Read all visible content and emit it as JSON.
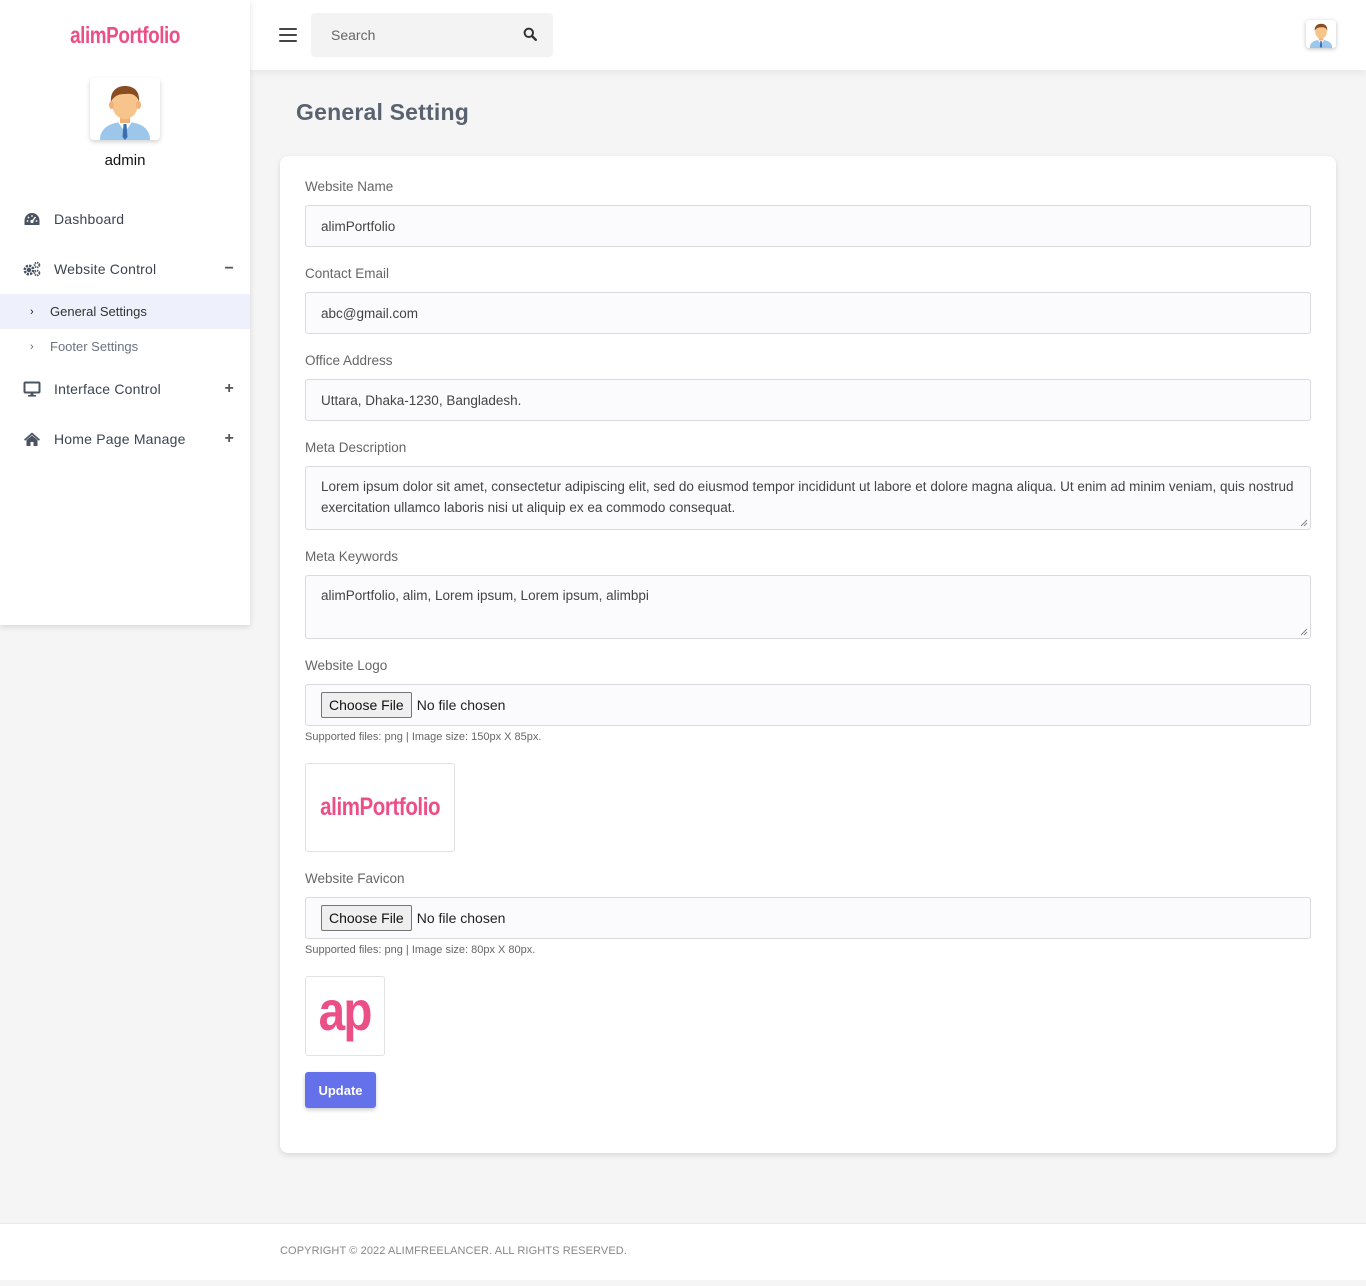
{
  "brand": {
    "name": "alimPortfolio"
  },
  "profile": {
    "name": "admin"
  },
  "nav": {
    "items": [
      {
        "label": "Dashboard",
        "icon": "dashboard-icon"
      },
      {
        "label": "Website Control",
        "icon": "cogs-icon",
        "toggle": "−"
      },
      {
        "label": "Interface Control",
        "icon": "monitor-icon",
        "toggle": "+"
      },
      {
        "label": "Home Page Manage",
        "icon": "home-icon",
        "toggle": "+"
      }
    ],
    "sub_items": [
      {
        "label": "General Settings",
        "active": true
      },
      {
        "label": "Footer Settings",
        "active": false
      }
    ]
  },
  "topbar": {
    "search_placeholder": "Search"
  },
  "page": {
    "title": "General Setting"
  },
  "form": {
    "website_name": {
      "label": "Website Name",
      "value": "alimPortfolio"
    },
    "contact_email": {
      "label": "Contact Email",
      "value": "abc@gmail.com"
    },
    "office_address": {
      "label": "Office Address",
      "value": "Uttara, Dhaka-1230, Bangladesh."
    },
    "meta_description": {
      "label": "Meta Description",
      "value": "Lorem ipsum dolor sit amet, consectetur adipiscing elit, sed do eiusmod tempor incididunt ut labore et dolore magna aliqua. Ut enim ad minim veniam, quis nostrud exercitation ullamco laboris nisi ut aliquip ex ea commodo consequat."
    },
    "meta_keywords": {
      "label": "Meta Keywords",
      "value": "alimPortfolio, alim, Lorem ipsum, Lorem ipsum, alimbpi"
    },
    "website_logo": {
      "label": "Website Logo",
      "button": "Choose File",
      "status": "No file chosen",
      "hint": "Supported files: png | Image size: 150px X 85px.",
      "preview_text": "alimPortfolio"
    },
    "website_favicon": {
      "label": "Website Favicon",
      "button": "Choose File",
      "status": "No file chosen",
      "hint": "Supported files: png | Image size: 80px X 80px.",
      "preview_text": "ap"
    },
    "submit_label": "Update"
  },
  "footer": {
    "text": "COPYRIGHT © 2022 ALIMFREELANCER. ALL RIGHTS RESERVED."
  },
  "colors": {
    "brand": "#ec4f86",
    "primary_button": "#6571ea",
    "active_nav_bg": "#eef0fc"
  }
}
